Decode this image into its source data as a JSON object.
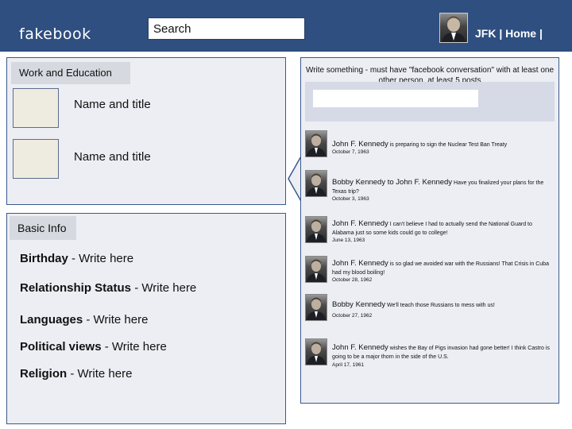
{
  "topbar": {
    "brand": "fakebook",
    "search_placeholder": "Search",
    "nav_user": "JFK",
    "nav_sep": " | ",
    "nav_home": "Home",
    "nav_tail": " |",
    "brand_color": "#2e4f80"
  },
  "work": {
    "header": "Work and Education",
    "items": [
      {
        "label": "Name and title"
      },
      {
        "label": "Name and title"
      }
    ]
  },
  "basic": {
    "header": "Basic Info",
    "fields": [
      {
        "label": "Birthday",
        "value": " - Write here"
      },
      {
        "label": "Relationship Status",
        "value": " - Write here"
      },
      {
        "label": "Languages",
        "value": " - Write here"
      },
      {
        "label": "Political views",
        "value": " - Write here"
      },
      {
        "label": "Religion",
        "value": " - Write here"
      }
    ]
  },
  "wall": {
    "prompt": "Write something - must have \"facebook conversation\" with at least one other person, at least 5 posts",
    "posts": [
      {
        "author": "John F. Kennedy",
        "text": " is preparing to sign the Nuclear Test Ban Treaty",
        "date": "October 7, 1963"
      },
      {
        "author": "Bobby Kennedy to John F. Kennedy",
        "text": " Have you finalized your plans for the Texas trip?",
        "date": "October 3, 1963"
      },
      {
        "author": "John F. Kennedy",
        "text": " I can't believe I had to actually send the National Guard to Alabama just so some kids could go to college!",
        "date": "June 13, 1963"
      },
      {
        "author": "John F. Kennedy",
        "text": " is so glad we avoided war with the Russians! That Crisis in Cuba had my blood boiling!",
        "date": "October 28, 1962"
      },
      {
        "author": "Bobby Kennedy",
        "text": " We'll teach those Russians to mess with us!",
        "date": "October 27, 1962"
      },
      {
        "author": "John F. Kennedy",
        "text": " wishes the Bay of Pigs invasion had gone better! I think Castro is going to be a major thorn in the side of the U.S.",
        "date": "April 17, 1961"
      }
    ]
  }
}
